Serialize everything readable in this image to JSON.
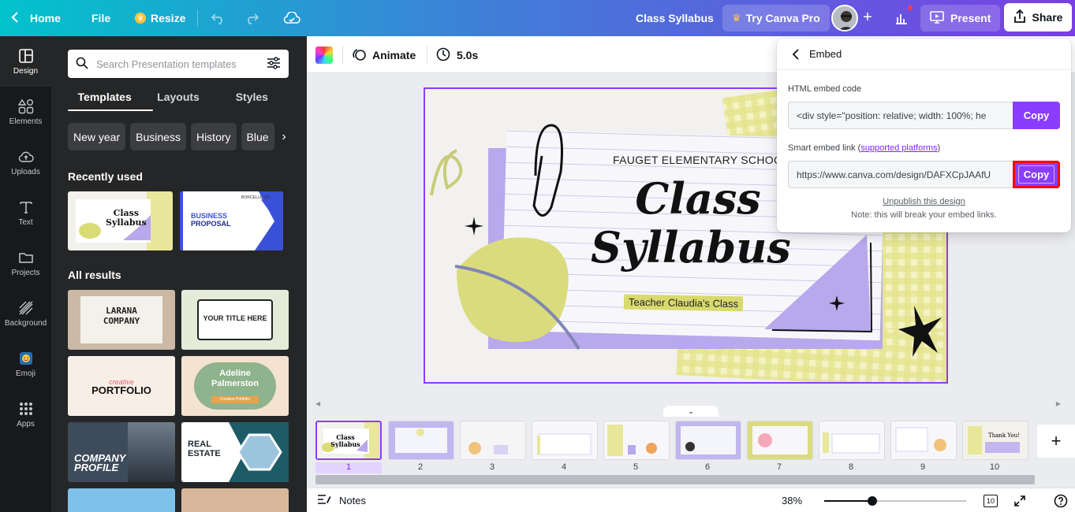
{
  "topbar": {
    "home": "Home",
    "file": "File",
    "resize": "Resize",
    "doc_title": "Class Syllabus",
    "try_pro": "Try Canva Pro",
    "present": "Present",
    "share": "Share"
  },
  "rail": [
    {
      "label": "Design",
      "icon": "layout-icon"
    },
    {
      "label": "Elements",
      "icon": "shapes-icon"
    },
    {
      "label": "Uploads",
      "icon": "cloud-upload-icon"
    },
    {
      "label": "Text",
      "icon": "text-icon"
    },
    {
      "label": "Projects",
      "icon": "folder-icon"
    },
    {
      "label": "Background",
      "icon": "hatch-icon"
    },
    {
      "label": "Emoji",
      "icon": "emoji-icon"
    },
    {
      "label": "Apps",
      "icon": "grid-icon"
    }
  ],
  "panel": {
    "search_placeholder": "Search Presentation templates",
    "tabs": [
      "Templates",
      "Layouts",
      "Styles"
    ],
    "chips": [
      "New year",
      "Business",
      "History",
      "Blue"
    ],
    "recently_used": "Recently used",
    "all_results": "All results",
    "recent_thumbs": [
      {
        "title_1": "Class",
        "title_2": "Syllabus"
      },
      {
        "title_1": "BUSINESS",
        "title_2": "PROPOSAL",
        "brand": "BORCELLE.CO"
      }
    ],
    "result_thumbs": [
      {
        "title_1": "LARANA",
        "title_2": "COMPANY"
      },
      {
        "title_1": "YOUR TITLE HERE"
      },
      {
        "title_1": "creative",
        "title_2": "PORTFOLIO"
      },
      {
        "title_1": "Adeline",
        "title_2": "Palmerston",
        "sub": "Creative Portfolio"
      },
      {
        "title_1": "COMPANY",
        "title_2": "PROFILE"
      },
      {
        "title_1": "REAL",
        "title_2": "ESTATE"
      }
    ]
  },
  "toolbar": {
    "animate": "Animate",
    "duration": "5.0s"
  },
  "slide": {
    "school": "FAUGET ELEMENTARY SCHOOL",
    "title_1": "Class",
    "title_2": "Syllabus",
    "teacher": "Teacher Claudia's Class"
  },
  "embed": {
    "title": "Embed",
    "html_label": "HTML embed code",
    "html_value": "<div style=\"position: relative; width: 100%; he",
    "copy_1": "Copy",
    "smart_label": "Smart embed link (",
    "smart_link": "supported platforms",
    "smart_close": ")",
    "smart_value": "https://www.canva.com/design/DAFXCpJAAfU",
    "copy_2": "Copy",
    "unpublish": "Unpublish this design",
    "note": "Note: this will break your embed links."
  },
  "pages": [
    "1",
    "2",
    "3",
    "4",
    "5",
    "6",
    "7",
    "8",
    "9",
    "10"
  ],
  "bottom": {
    "notes": "Notes",
    "zoom": "38%",
    "zoom_level": 0.34,
    "page_count": "10"
  },
  "colors": {
    "accent": "#8b3dff",
    "slide_lavender": "#b8a8ec",
    "slide_yellow": "#e6e48a",
    "highlight": "#ff0000"
  }
}
